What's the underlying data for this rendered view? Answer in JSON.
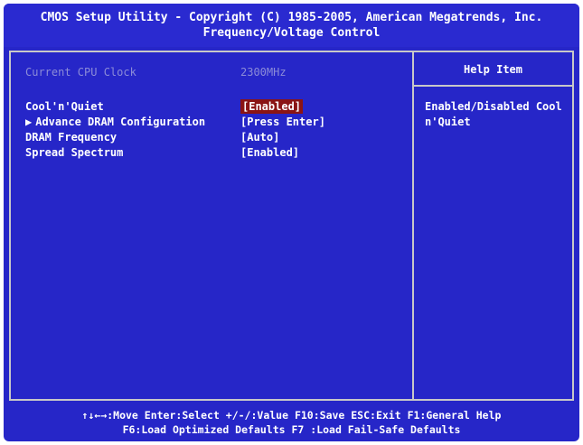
{
  "header": {
    "line1": "CMOS Setup Utility - Copyright (C) 1985-2005, American Megatrends, Inc.",
    "line2": "Frequency/Voltage Control"
  },
  "items": [
    {
      "label": "Current CPU Clock",
      "value": "2300MHz"
    },
    {
      "label": "Cool'n'Quiet",
      "value": "[Enabled]"
    },
    {
      "label": "Advance DRAM Configuration",
      "value": "[Press Enter]"
    },
    {
      "label": "DRAM Frequency",
      "value": "[Auto]"
    },
    {
      "label": "Spread Spectrum",
      "value": "[Enabled]"
    }
  ],
  "help": {
    "title": "Help Item",
    "text": "Enabled/Disabled Cool n'Quiet"
  },
  "footer": {
    "line1": "↑↓←→:Move  Enter:Select  +/-/:Value  F10:Save  ESC:Exit  F1:General Help",
    "line2": "F6:Load Optimized Defaults      F7 :Load Fail-Safe Defaults"
  },
  "icons": {
    "submenu": "triangle-right-icon"
  },
  "colors": {
    "background": "#2626c8",
    "highlight": "#8a1414",
    "border": "#c8c8c8"
  }
}
